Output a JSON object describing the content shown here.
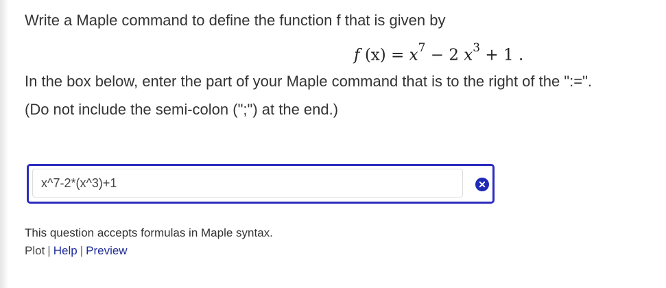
{
  "question": {
    "prompt": "Write a Maple command to define the function f that is given by",
    "formula": {
      "fname": "f",
      "arg": "(x) = ",
      "var1": "x",
      "exp1": "7",
      "mid": " − 2 ",
      "var2": "x",
      "exp2": "3",
      "tail": " + 1 ."
    },
    "instruction_line1": "In the box below, enter the part of your Maple command that is to the right of the \":=\".",
    "instruction_line2": "(Do not include the semi-colon (\";\") at the end.)"
  },
  "answer": {
    "value": "x^7-2*(x^3)+1",
    "clear_icon": "close-circle-icon"
  },
  "footer": {
    "syntax_note": "This question accepts formulas in Maple syntax.",
    "plot_label": "Plot",
    "separator": "|",
    "help_label": "Help",
    "preview_label": "Preview"
  },
  "colors": {
    "focus_border": "#2b2bbf",
    "link": "#1e2c9a",
    "clear_button": "#1f2bb5"
  }
}
